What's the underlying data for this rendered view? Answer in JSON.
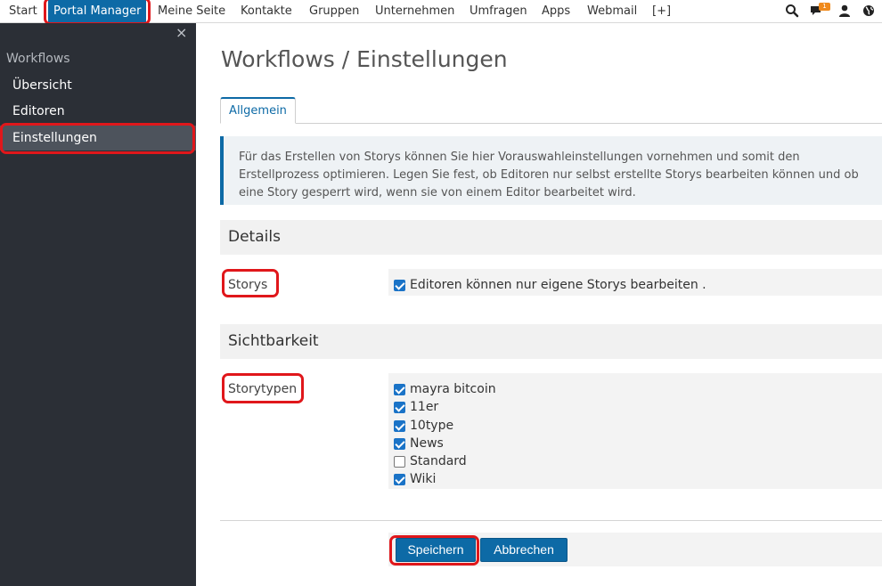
{
  "topnav": {
    "items": [
      "Start",
      "Portal Manager",
      "Meine Seite",
      "Kontakte",
      "Gruppen",
      "Unternehmen",
      "Umfragen",
      "Apps",
      "Webmail",
      "[+]"
    ],
    "active_index": 1,
    "notification_count": "1",
    "icons": [
      "search-icon",
      "chat-icon",
      "user-icon",
      "globe-icon"
    ]
  },
  "sidebar": {
    "close_glyph": "×",
    "heading": "Workflows",
    "items": [
      {
        "label": "Übersicht"
      },
      {
        "label": "Editoren"
      },
      {
        "label": "Einstellungen"
      }
    ],
    "active_index": 2
  },
  "main": {
    "title": "Workflows / Einstellungen",
    "tabs": [
      {
        "label": "Allgemein"
      }
    ],
    "info_text": "Für das Erstellen von Storys können Sie hier Vorauswahleinstellungen vornehmen und somit den Erstellprozess optimieren. Legen Sie fest, ob Editoren nur selbst erstellte Storys bearbeiten können und ob eine Story gesperrt wird, wenn sie von einem Editor bearbeitet wird.",
    "sections": [
      {
        "title": "Details",
        "label": "Storys",
        "options": [
          {
            "label": "Editoren können nur eigene Storys bearbeiten .",
            "checked": true
          }
        ]
      },
      {
        "title": "Sichtbarkeit",
        "label": "Storytypen",
        "options": [
          {
            "label": "mayra bitcoin",
            "checked": true
          },
          {
            "label": "11er",
            "checked": true
          },
          {
            "label": "10type",
            "checked": true
          },
          {
            "label": "News",
            "checked": true
          },
          {
            "label": "Standard",
            "checked": false
          },
          {
            "label": "Wiki",
            "checked": true
          }
        ]
      }
    ],
    "buttons": {
      "save": "Speichern",
      "cancel": "Abbrechen"
    }
  },
  "colors": {
    "accent": "#0d6aa6",
    "highlight": "#e0171b",
    "sidebar": "#2b2f36",
    "badge": "#f08a1c"
  }
}
